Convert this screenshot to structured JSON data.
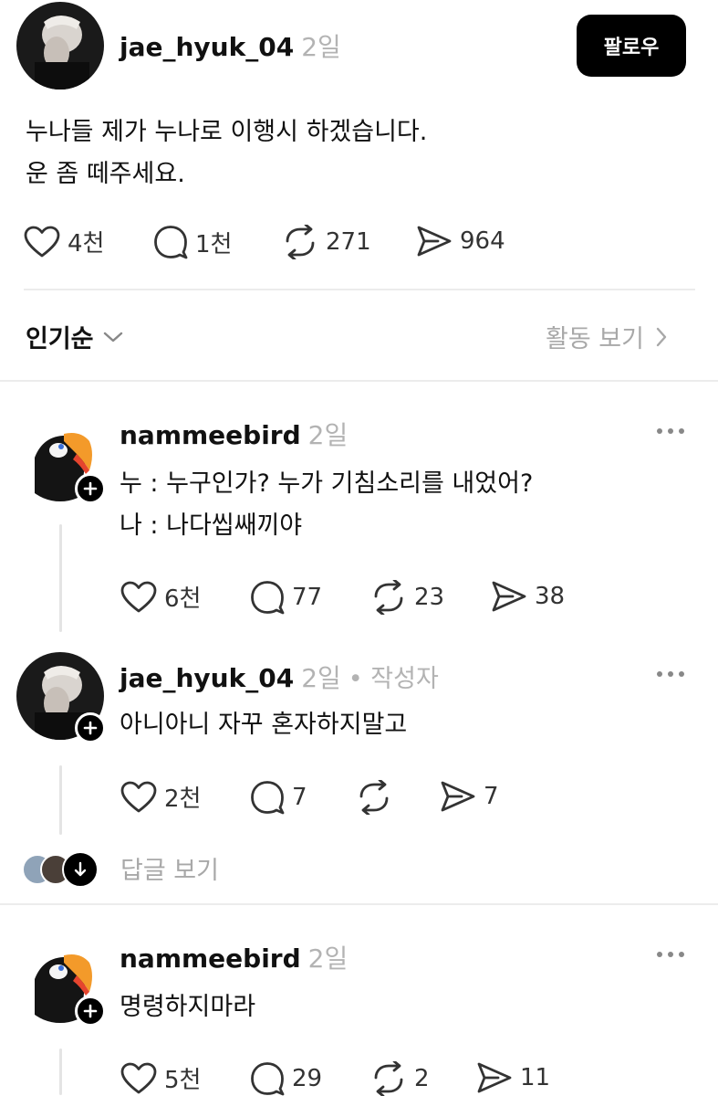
{
  "post": {
    "username": "jae_hyuk_04",
    "time": "2일",
    "follow_label": "팔로우",
    "text_line1": "누나들 제가 누나로 이행시 하겠습니다.",
    "text_line2": "운 좀 떼주세요.",
    "likes": "4천",
    "comments": "1천",
    "reposts": "271",
    "shares": "964"
  },
  "sort": {
    "label": "인기순",
    "activity_label": "활동 보기"
  },
  "replies": [
    {
      "username": "nammeebird",
      "time": "2일",
      "line1": "누 : 누구인가? 누가 기침소리를 내었어?",
      "line2": "나 : 나다씹쌔끼야",
      "likes": "6천",
      "comments": "77",
      "reposts": "23",
      "shares": "38"
    },
    {
      "username": "jae_hyuk_04",
      "time": "2일",
      "author_tag": "• 작성자",
      "line1": "아니아니 자꾸 혼자하지말고",
      "likes": "2천",
      "comments": "7",
      "reposts": "",
      "shares": "7"
    },
    {
      "username": "nammeebird",
      "time": "2일",
      "line1": "명령하지마라",
      "likes": "5천",
      "comments": "29",
      "reposts": "2",
      "shares": "11"
    }
  ],
  "view_replies_label": "답글 보기",
  "colors": {
    "text": "#111111",
    "muted": "#b3b3b3",
    "icon": "#333333",
    "divider": "#ececec",
    "button_bg": "#000000"
  }
}
